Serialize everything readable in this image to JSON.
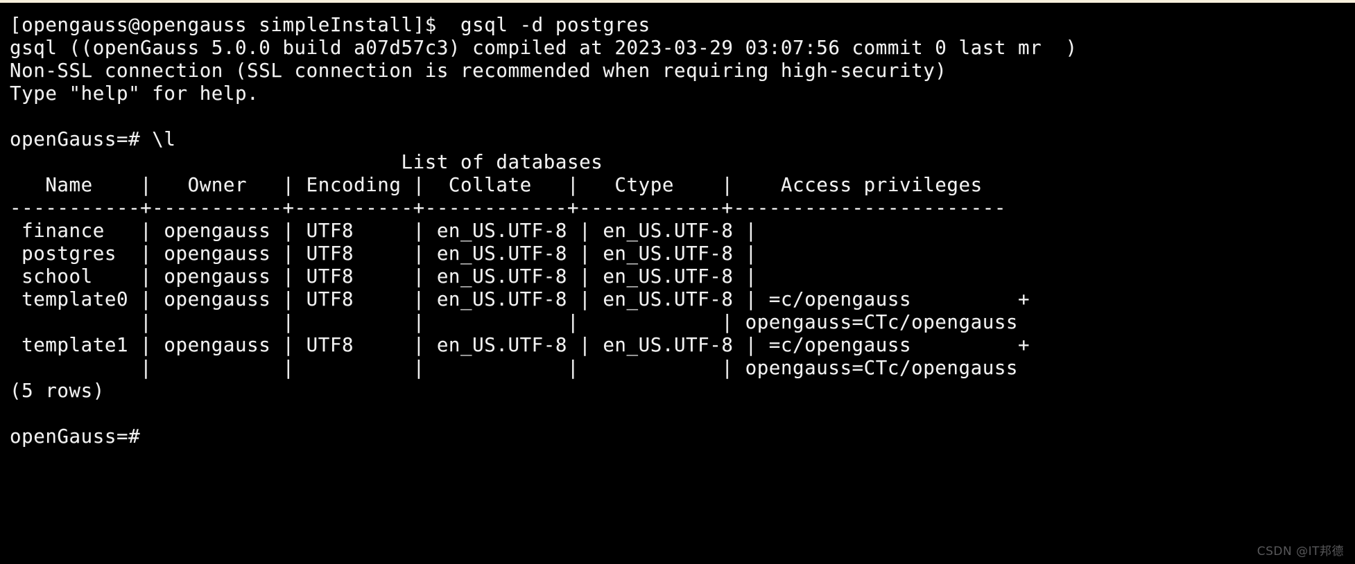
{
  "window": {
    "type": "terminal-emulator",
    "background_color": "#000000",
    "foreground_color": "#f2f2f2",
    "top_strip_color": "#f7f0dc"
  },
  "session": {
    "shell_prompt": "[opengauss@opengauss simpleInstall]$",
    "command": "gsql -d postgres",
    "db_prompt": "openGauss=#",
    "meta_command": "\\l"
  },
  "terminal_lines": [
    "[opengauss@opengauss simpleInstall]$  gsql -d postgres",
    "gsql ((openGauss 5.0.0 build a07d57c3) compiled at 2023-03-29 03:07:56 commit 0 last mr  )",
    "Non-SSL connection (SSL connection is recommended when requiring high-security)",
    "Type \"help\" for help.",
    "",
    "openGauss=# \\l",
    "                                 List of databases",
    "   Name    |   Owner   | Encoding |  Collate   |   Ctype    |    Access privileges",
    "-----------+-----------+----------+------------+------------+-----------------------",
    " finance   | opengauss | UTF8     | en_US.UTF-8 | en_US.UTF-8 |",
    " postgres  | opengauss | UTF8     | en_US.UTF-8 | en_US.UTF-8 |",
    " school    | opengauss | UTF8     | en_US.UTF-8 | en_US.UTF-8 |",
    " template0 | opengauss | UTF8     | en_US.UTF-8 | en_US.UTF-8 | =c/opengauss         +",
    "           |           |          |            |            | opengauss=CTc/opengauss",
    " template1 | opengauss | UTF8     | en_US.UTF-8 | en_US.UTF-8 | =c/opengauss         +",
    "           |           |          |            |            | opengauss=CTc/opengauss",
    "(5 rows)",
    "",
    "openGauss=#"
  ],
  "banner": {
    "version_line": "gsql ((openGauss 5.0.0 build a07d57c3) compiled at 2023-03-29 03:07:56 commit 0 last mr  )",
    "ssl_line": "Non-SSL connection (SSL connection is recommended when requiring high-security)",
    "help_line": "Type \"help\" for help.",
    "product": "openGauss",
    "version": "5.0.0",
    "build": "a07d57c3",
    "compiled_at": "2023-03-29 03:07:56",
    "commit": "0",
    "last_mr": ""
  },
  "table": {
    "title": "List of databases",
    "columns": [
      "Name",
      "Owner",
      "Encoding",
      "Collate",
      "Ctype",
      "Access privileges"
    ],
    "rows": [
      {
        "name": "finance",
        "owner": "opengauss",
        "encoding": "UTF8",
        "collate": "en_US.UTF-8",
        "ctype": "en_US.UTF-8",
        "access_privileges": ""
      },
      {
        "name": "postgres",
        "owner": "opengauss",
        "encoding": "UTF8",
        "collate": "en_US.UTF-8",
        "ctype": "en_US.UTF-8",
        "access_privileges": ""
      },
      {
        "name": "school",
        "owner": "opengauss",
        "encoding": "UTF8",
        "collate": "en_US.UTF-8",
        "ctype": "en_US.UTF-8",
        "access_privileges": ""
      },
      {
        "name": "template0",
        "owner": "opengauss",
        "encoding": "UTF8",
        "collate": "en_US.UTF-8",
        "ctype": "en_US.UTF-8",
        "access_privileges": "=c/opengauss\nopengauss=CTc/opengauss"
      },
      {
        "name": "template1",
        "owner": "opengauss",
        "encoding": "UTF8",
        "collate": "en_US.UTF-8",
        "ctype": "en_US.UTF-8",
        "access_privileges": "=c/opengauss\nopengauss=CTc/opengauss"
      }
    ],
    "row_count_label": "(5 rows)",
    "row_count": 5
  },
  "watermark": {
    "text": "CSDN @IT邦德",
    "color": "#58585a"
  }
}
